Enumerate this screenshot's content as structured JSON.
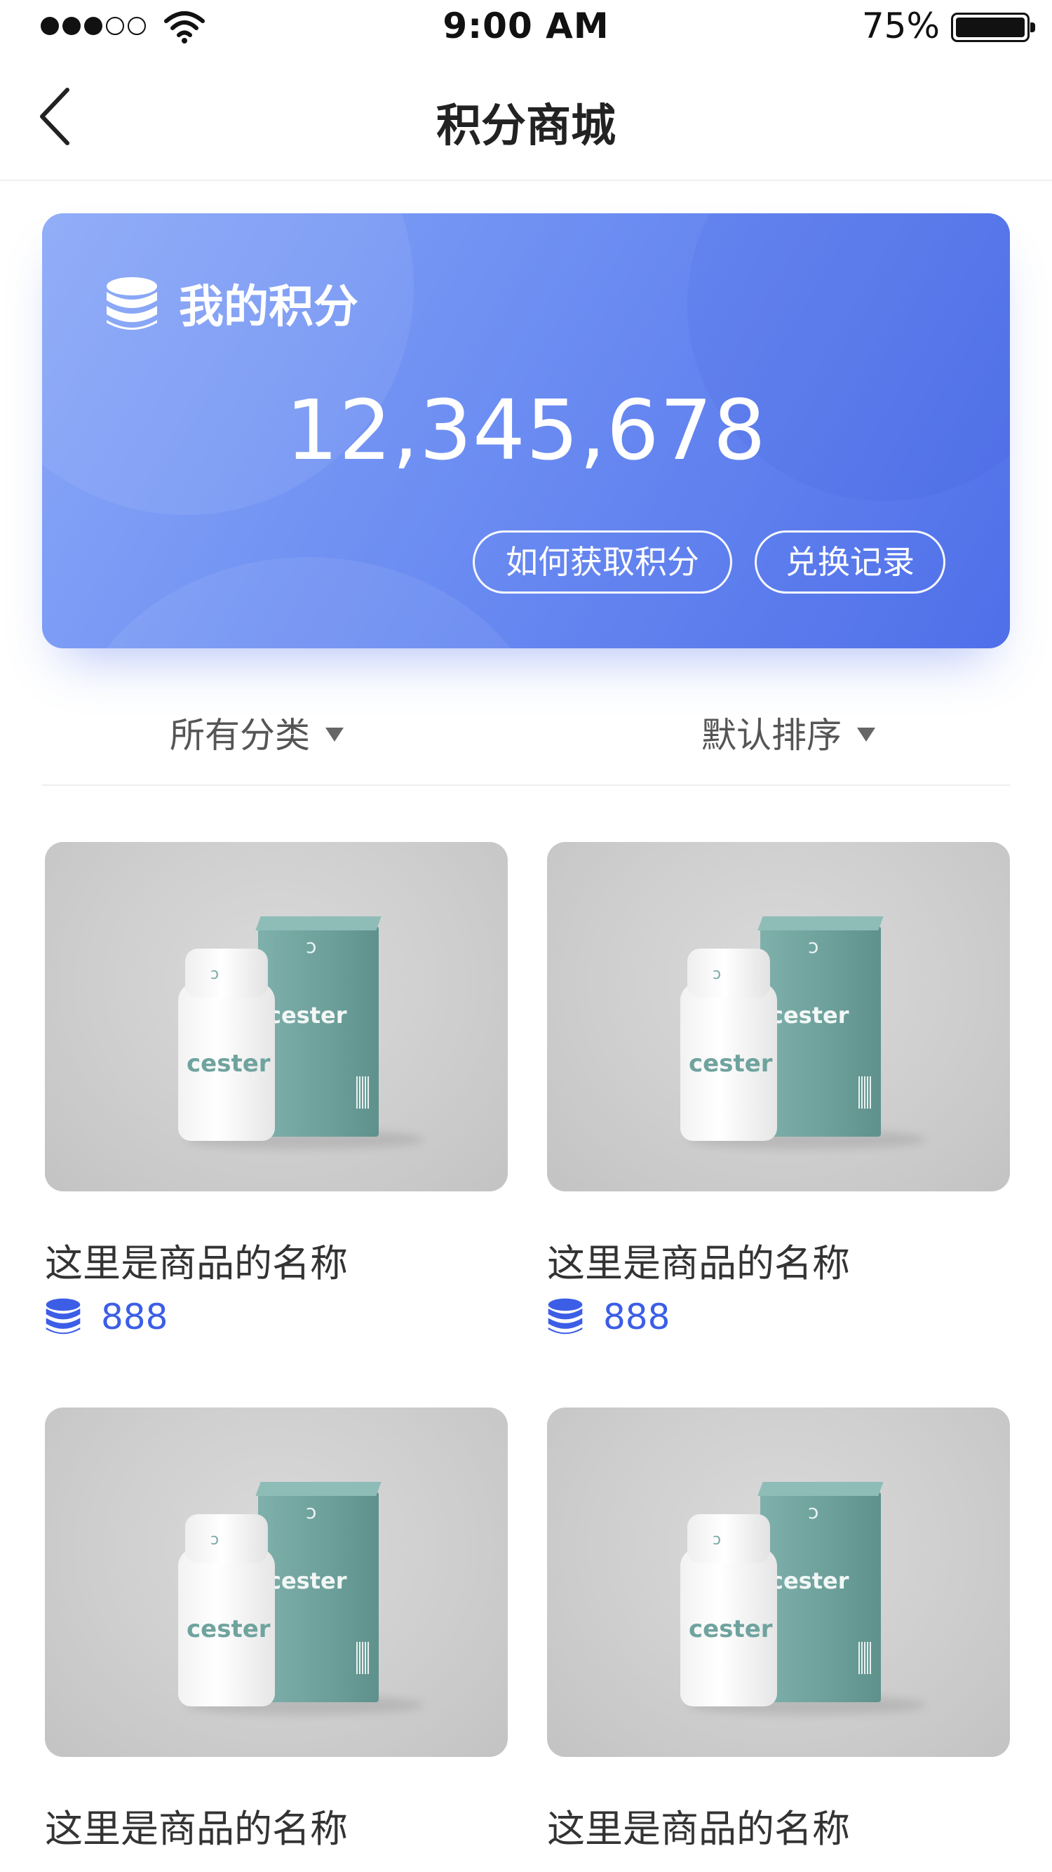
{
  "status_bar": {
    "time": "9:00 AM",
    "battery": "75%",
    "battery_level": 0.75,
    "signal_bars": 3,
    "signal_total": 5
  },
  "nav": {
    "title": "积分商城",
    "back_icon": "chevron-left-icon"
  },
  "points_card": {
    "label": "我的积分",
    "value": "12,345,678",
    "icon": "coins-icon",
    "how_to_earn_label": "如何获取积分",
    "history_label": "兑换记录"
  },
  "filters": {
    "category_label": "所有分类",
    "sort_label": "默认排序"
  },
  "products": [
    {
      "name": "这里是商品的名称",
      "price": "888",
      "image_brand": "cester"
    },
    {
      "name": "这里是商品的名称",
      "price": "888",
      "image_brand": "cester"
    },
    {
      "name": "这里是商品的名称",
      "price": "",
      "image_brand": "cester"
    },
    {
      "name": "这里是商品的名称",
      "price": "",
      "image_brand": "cester"
    }
  ],
  "colors": {
    "accent": "#3c5ee6",
    "card_gradient_start": "#8aa8f8",
    "card_gradient_end": "#4f6fe9"
  }
}
